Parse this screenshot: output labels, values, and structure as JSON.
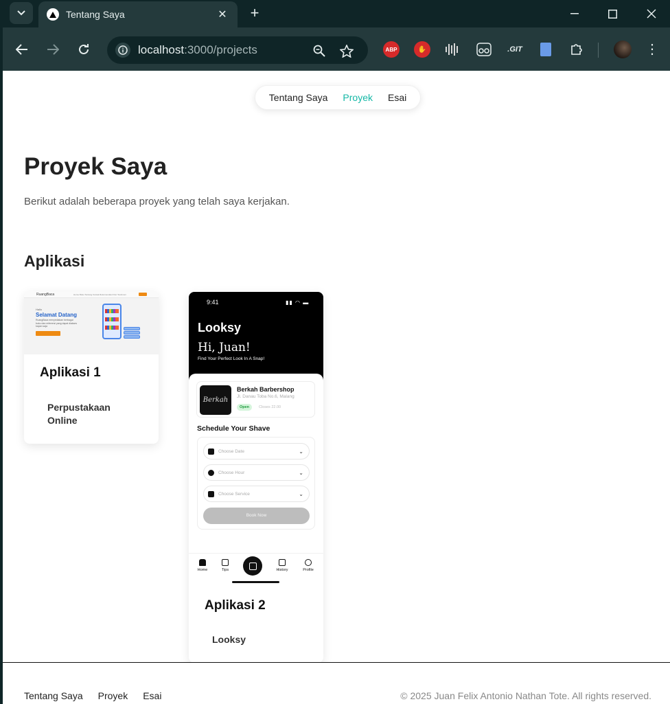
{
  "browser": {
    "tab_title": "Tentang Saya",
    "url_host": "localhost",
    "url_rest": ":3000/projects",
    "extensions": [
      "ABP",
      "hand-stop",
      "audio-bars",
      "glasses",
      ".GIT",
      "document",
      "puzzle"
    ]
  },
  "nav": {
    "items": [
      "Tentang Saya",
      "Proyek",
      "Esai"
    ],
    "active": "Proyek"
  },
  "main": {
    "title": "Proyek Saya",
    "subtitle": "Berikut adalah beberapa proyek yang telah saya kerjakan.",
    "section": "Aplikasi"
  },
  "projects": [
    {
      "title": "Aplikasi 1",
      "desc": "Perpustakaan Online",
      "thumb": {
        "brand": "RuangBaca",
        "menu": "Home   Buku   Tentang   Kontak   Rekomendasi   Fitur   Testimoni",
        "hello": "Hallo",
        "welcome": "Selamat Datang",
        "lorem": "RuangBaca menyediakan berbagai buku dan referensi yang dapat diakses kapan saja"
      }
    },
    {
      "title": "Aplikasi 2",
      "desc": "Looksy",
      "thumb": {
        "time": "9:41",
        "logo": "Looksy",
        "greeting": "Hi, Juan!",
        "tagline": "Find Your Perfect Look In A Snap!",
        "shop_name": "Berkah Barbershop",
        "shop_addr": "Jl. Danau Toba No.6, Malang",
        "shop_img": "Berkah",
        "open": "Open",
        "closes": "Closes 22.00",
        "schedule": "Schedule Your Shave",
        "date": "Choose Date",
        "hour": "Choose Hour",
        "service": "Choose Service",
        "book": "Book Now",
        "tabs": [
          "Home",
          "Tips",
          "History",
          "Profile"
        ]
      }
    }
  ],
  "footer": {
    "links": [
      "Tentang Saya",
      "Proyek",
      "Esai"
    ],
    "copyright": "© 2025 Juan Felix Antonio Nathan Tote. All rights reserved."
  },
  "colors": {
    "accent": "#14b8a6",
    "chrome_dark": "#0f2527",
    "chrome_toolbar": "#243a3c"
  }
}
